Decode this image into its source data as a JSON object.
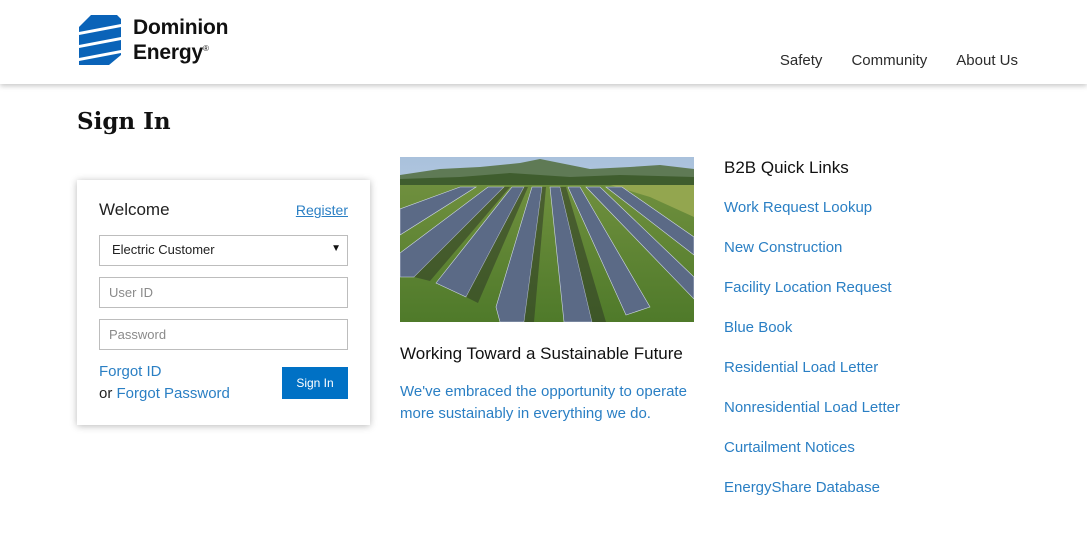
{
  "header": {
    "logo": {
      "line1": "Dominion",
      "line2": "Energy",
      "reg": "®"
    },
    "nav": [
      {
        "label": "Safety"
      },
      {
        "label": "Community"
      },
      {
        "label": "About Us"
      }
    ]
  },
  "page_title": "Sign In",
  "signin_card": {
    "welcome": "Welcome",
    "register": "Register",
    "account_type_selected": "Electric Customer",
    "user_id_placeholder": "User ID",
    "password_placeholder": "Password",
    "forgot_id": "Forgot ID",
    "or_text": "or",
    "forgot_password": "Forgot Password",
    "signin_button": "Sign In"
  },
  "feature": {
    "title": "Working Toward a Sustainable Future",
    "description": "We've embraced the opportunity to operate more sustainably in everything we do."
  },
  "quick_links": {
    "title": "B2B Quick Links",
    "items": [
      {
        "label": "Work Request Lookup"
      },
      {
        "label": "New Construction"
      },
      {
        "label": "Facility Location Request"
      },
      {
        "label": "Blue Book"
      },
      {
        "label": "Residential Load Letter"
      },
      {
        "label": "Nonresidential Load Letter"
      },
      {
        "label": "Curtailment Notices"
      },
      {
        "label": "EnergyShare Database"
      }
    ]
  },
  "colors": {
    "brand_blue": "#0071c5",
    "link_blue": "#2a7fc4",
    "text_dark": "#111111"
  }
}
